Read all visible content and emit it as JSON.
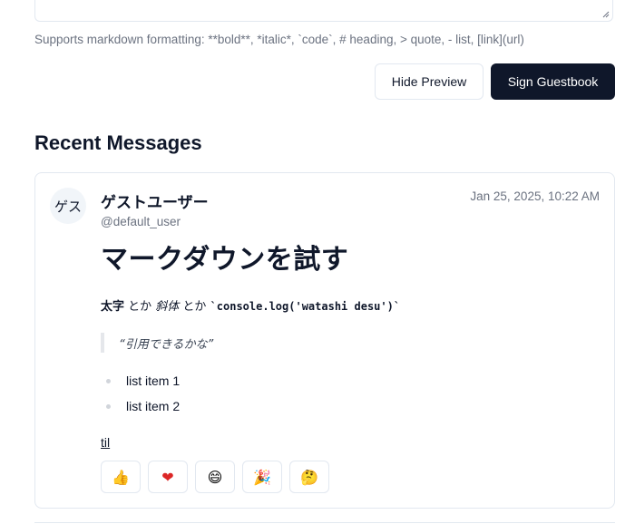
{
  "form": {
    "hint": "Supports markdown formatting: **bold**, *italic*, `code`, # heading, > quote, - list, [link](url)",
    "hide_preview_label": "Hide Preview",
    "sign_label": "Sign Guestbook"
  },
  "recent": {
    "title": "Recent Messages"
  },
  "message": {
    "avatar_text": "ゲス",
    "author_name": "ゲストユーザー",
    "author_handle": "@default_user",
    "timestamp": "Jan 25, 2025, 10:22 AM",
    "heading": "マークダウンを試す",
    "para_bold": "太字",
    "para_sep1": " とか ",
    "para_italic": "斜体",
    "para_sep2": " とか ",
    "para_code": "`console.log('watashi desu')`",
    "quote": "“引用できるかな”",
    "list_items": [
      "list item 1",
      "list item 2"
    ],
    "link_text": "til",
    "reactions": [
      {
        "emoji": "👍",
        "icon": "thumbs-up-icon"
      },
      {
        "emoji": "❤",
        "icon": "heart-icon"
      },
      {
        "emoji": "😄",
        "icon": "smile-icon"
      },
      {
        "emoji": "🎉",
        "icon": "party-icon"
      },
      {
        "emoji": "🤔",
        "icon": "thinking-icon"
      }
    ]
  },
  "colors": {
    "primary": "#0f172a",
    "border": "#e2e8f0",
    "muted": "#6b7280",
    "heart": "#dc2626"
  }
}
